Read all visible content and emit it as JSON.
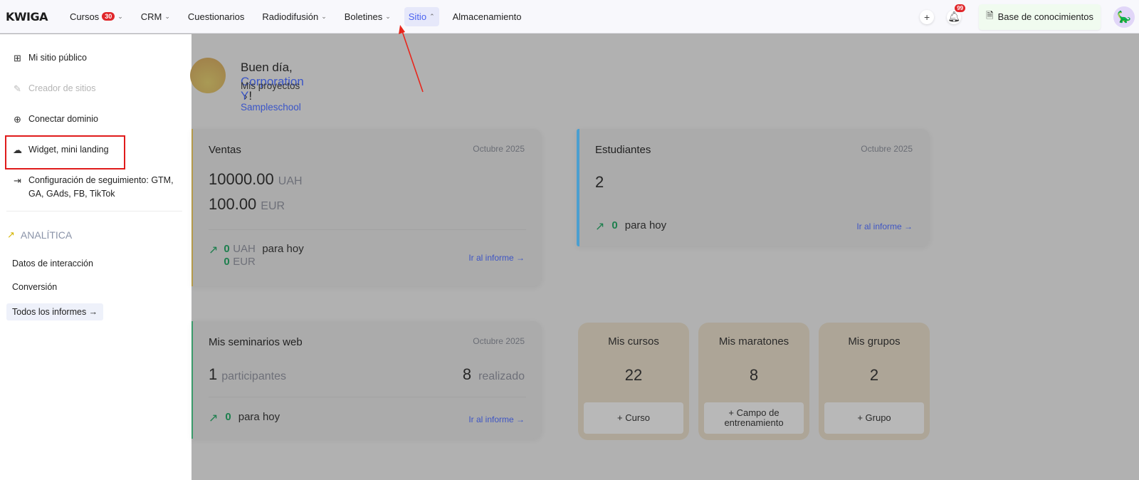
{
  "header": {
    "logo": "KWIGA",
    "nav": [
      {
        "label": "Cursos",
        "badge": "30",
        "chevron": "⌄"
      },
      {
        "label": "CRM",
        "chevron": "⌄"
      },
      {
        "label": "Cuestionarios"
      },
      {
        "label": "Radiodifusión",
        "chevron": "⌄"
      },
      {
        "label": "Boletines",
        "chevron": "⌄"
      },
      {
        "label": "Sitio",
        "chevron": "⌃",
        "active": true
      },
      {
        "label": "Almacenamiento"
      }
    ],
    "plus": "+",
    "notifications": "99",
    "knowledge_base": "Base de conocimientos"
  },
  "sidebar": {
    "items": [
      {
        "label": "Mi sitio público",
        "icon": "grid-icon"
      },
      {
        "label": "Creador de sitios",
        "icon": "brush-icon",
        "disabled": true
      },
      {
        "label": "Conectar dominio",
        "icon": "globe-icon"
      },
      {
        "label": "Widget, mini landing",
        "icon": "cloud-share-icon"
      },
      {
        "label": "Configuración de seguimiento: GTM,",
        "label2": "GA, GAds, FB, TikTok",
        "icon": "tracking-icon"
      }
    ],
    "analytics_title": "ANALÍTICA",
    "analytics": [
      "Datos de interacción",
      "Conversión"
    ],
    "all_reports": "Todos los informes →"
  },
  "greeting": {
    "prefix": "Buen día, ",
    "name": "Corporation Y",
    "suffix": "!",
    "crumb1": "Mis proyectos",
    "sep": "›",
    "crumb2": "Sampleschool"
  },
  "sales": {
    "title": "Ventas",
    "date": "Octubre 2025",
    "amount1": "10000.00",
    "unit1": "UAH",
    "amount2": "100.00",
    "unit2": "EUR",
    "today1": "0",
    "today_unit1": "UAH",
    "today_label": "para hoy",
    "today2": "0",
    "today_unit2": "EUR",
    "link": "Ir al informe →"
  },
  "students": {
    "title": "Estudiantes",
    "date": "Octubre 2025",
    "count": "2",
    "today": "0",
    "today_label": "para hoy",
    "link": "Ir al informe →"
  },
  "webinars": {
    "title": "Mis seminarios web",
    "date": "Octubre 2025",
    "participants": "1",
    "participants_label": "participantes",
    "done": "8",
    "done_label": "realizado",
    "today": "0",
    "today_label": "para hoy",
    "link": "Ir al informe →"
  },
  "tiles": [
    {
      "title": "Mis cursos",
      "count": "22",
      "button": "+ Curso"
    },
    {
      "title": "Mis maratones",
      "count": "8",
      "button": "+ Campo de entrenamiento"
    },
    {
      "title": "Mis grupos",
      "count": "2",
      "button": "+ Grupo"
    }
  ]
}
